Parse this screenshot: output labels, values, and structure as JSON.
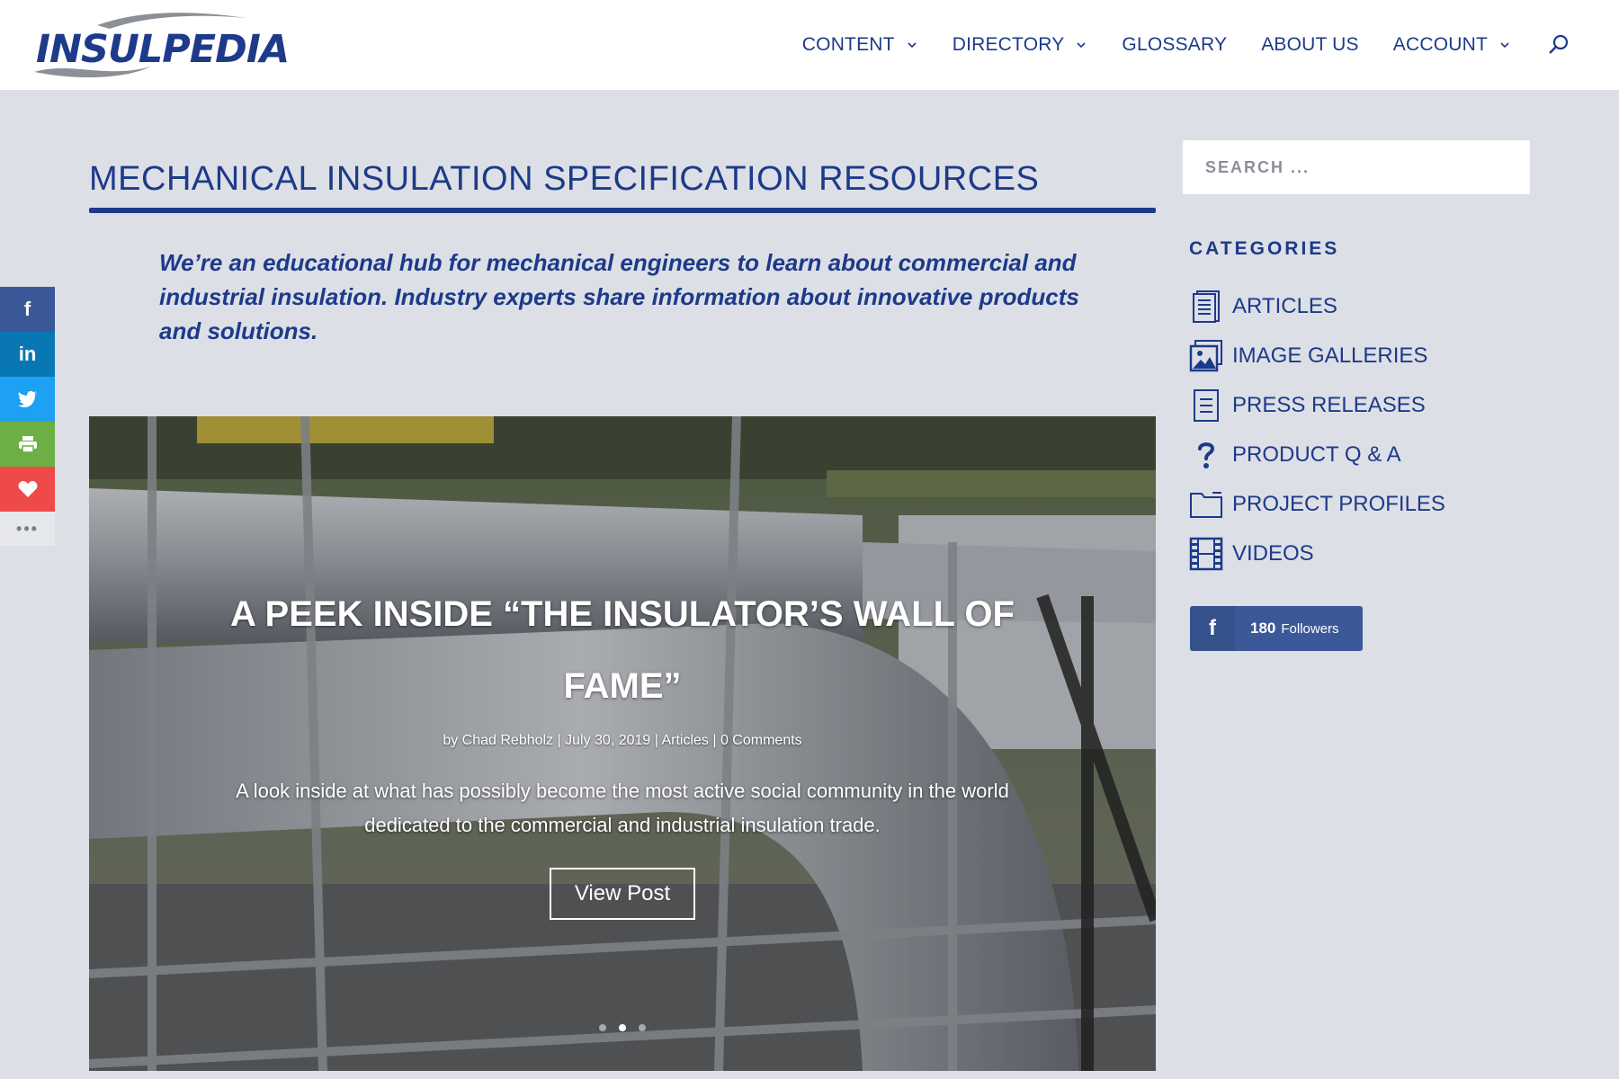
{
  "header": {
    "logo_text": "INSULPEDIA",
    "nav": [
      {
        "label": "CONTENT",
        "dropdown": true
      },
      {
        "label": "DIRECTORY",
        "dropdown": true
      },
      {
        "label": "GLOSSARY",
        "dropdown": false
      },
      {
        "label": "ABOUT US",
        "dropdown": false
      },
      {
        "label": "ACCOUNT",
        "dropdown": true
      }
    ],
    "search_icon": "search-icon"
  },
  "social": [
    {
      "name": "facebook",
      "glyph": "f",
      "color": "#3b5998"
    },
    {
      "name": "linkedin",
      "glyph": "in",
      "color": "#0a77b5"
    },
    {
      "name": "twitter",
      "glyph": "twitter-bird",
      "color": "#1da1f2"
    },
    {
      "name": "print",
      "glyph": "printer",
      "color": "#6cb045"
    },
    {
      "name": "favorite",
      "glyph": "heart",
      "color": "#ee4a4a"
    },
    {
      "name": "more",
      "glyph": "•••"
    }
  ],
  "main": {
    "title": "MECHANICAL INSULATION SPECIFICATION RESOURCES",
    "intro": "We’re an educational hub for mechanical engineers to learn about commercial and industrial insulation. Industry experts share information about innovative products and solutions."
  },
  "hero": {
    "title": "A PEEK INSIDE “THE INSULATOR’S WALL OF FAME”",
    "meta": "by Chad Rebholz | July 30, 2019 | Articles | 0 Comments",
    "excerpt": "A look inside at what has possibly become the most active social community in the world dedicated to the commercial and industrial insulation trade.",
    "button": "View Post",
    "slides_total": 3,
    "slide_active": 2
  },
  "sidebar": {
    "search_placeholder": "SEARCH ...",
    "categories_heading": "CATEGORIES",
    "categories": [
      {
        "label": "ARTICLES",
        "icon": "document-icon"
      },
      {
        "label": "IMAGE GALLERIES",
        "icon": "image-gallery-icon"
      },
      {
        "label": "PRESS RELEASES",
        "icon": "press-release-icon"
      },
      {
        "label": "PRODUCT Q & A",
        "icon": "question-icon"
      },
      {
        "label": "PROJECT PROFILES",
        "icon": "folder-icon"
      },
      {
        "label": "VIDEOS",
        "icon": "film-icon"
      }
    ],
    "facebook_follow": {
      "count": "180",
      "label": "Followers"
    }
  },
  "colors": {
    "brand": "#1d3a8a",
    "background": "#dcdfe5"
  }
}
